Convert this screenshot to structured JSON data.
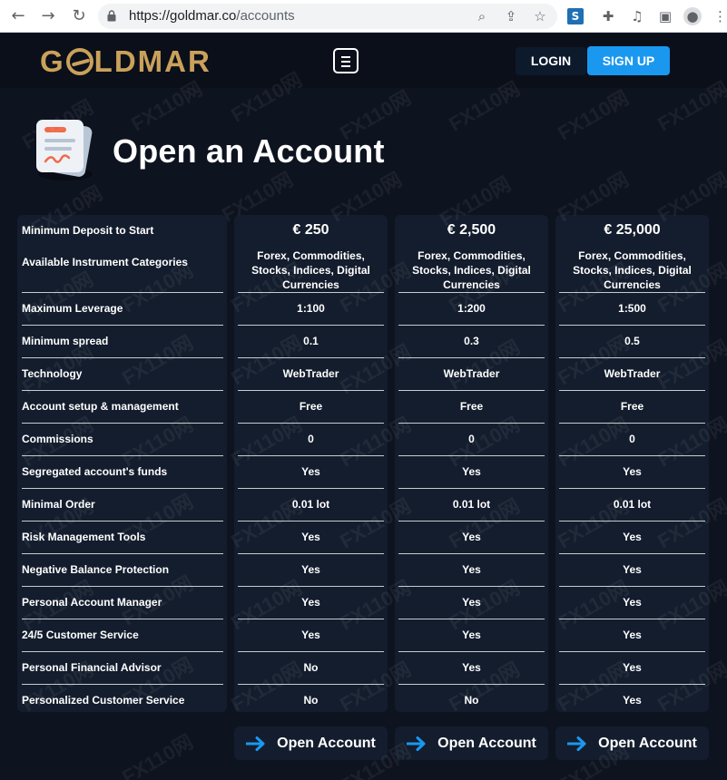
{
  "browser": {
    "url_host": "https://goldmar.co",
    "url_path": "/accounts"
  },
  "header": {
    "logo_text": "GOLDMAR",
    "login_label": "LOGIN",
    "signup_label": "SIGN UP"
  },
  "page": {
    "title": "Open an Account"
  },
  "table": {
    "row_labels": [
      "Minimum Deposit to Start",
      "Available Instrument Categories",
      "Maximum Leverage",
      "Minimum spread",
      "Technology",
      "Account setup & management",
      "Commissions",
      "Segregated account's funds",
      "Minimal Order",
      "Risk Management Tools",
      "Negative Balance Protection",
      "Personal Account Manager",
      "24/5 Customer Service",
      "Personal Financial Advisor",
      "Personalized Customer Service"
    ],
    "plans": [
      {
        "cells": [
          "€ 250",
          "Forex, Commodities, Stocks, Indices, Digital Currencies",
          "1:100",
          "0.1",
          "WebTrader",
          "Free",
          "0",
          "Yes",
          "0.01 lot",
          "Yes",
          "Yes",
          "Yes",
          "Yes",
          "No",
          "No"
        ],
        "button_label": "Open Account"
      },
      {
        "cells": [
          "€ 2,500",
          "Forex, Commodities, Stocks, Indices, Digital Currencies",
          "1:200",
          "0.3",
          "WebTrader",
          "Free",
          "0",
          "Yes",
          "0.01 lot",
          "Yes",
          "Yes",
          "Yes",
          "Yes",
          "Yes",
          "No"
        ],
        "button_label": "Open Account"
      },
      {
        "cells": [
          "€ 25,000",
          "Forex, Commodities, Stocks, Indices, Digital Currencies",
          "1:500",
          "0.5",
          "WebTrader",
          "Free",
          "0",
          "Yes",
          "0.01 lot",
          "Yes",
          "Yes",
          "Yes",
          "Yes",
          "Yes",
          "Yes"
        ],
        "button_label": "Open Account"
      }
    ]
  },
  "watermark_text": "FX110网",
  "colors": {
    "background": "#0e1320",
    "panel": "#141d2d",
    "brand_gold": "#caa15a",
    "accent_blue": "#1a98f0"
  },
  "icons": [
    "back-icon",
    "forward-icon",
    "reload-icon",
    "lock-icon",
    "zoom-icon",
    "share-icon",
    "star-icon",
    "extension-icon",
    "puzzle-icon",
    "media-icon",
    "sidebar-icon",
    "profile-icon",
    "more-icon",
    "hamburger-icon",
    "document-icon",
    "arrow-right-icon"
  ]
}
